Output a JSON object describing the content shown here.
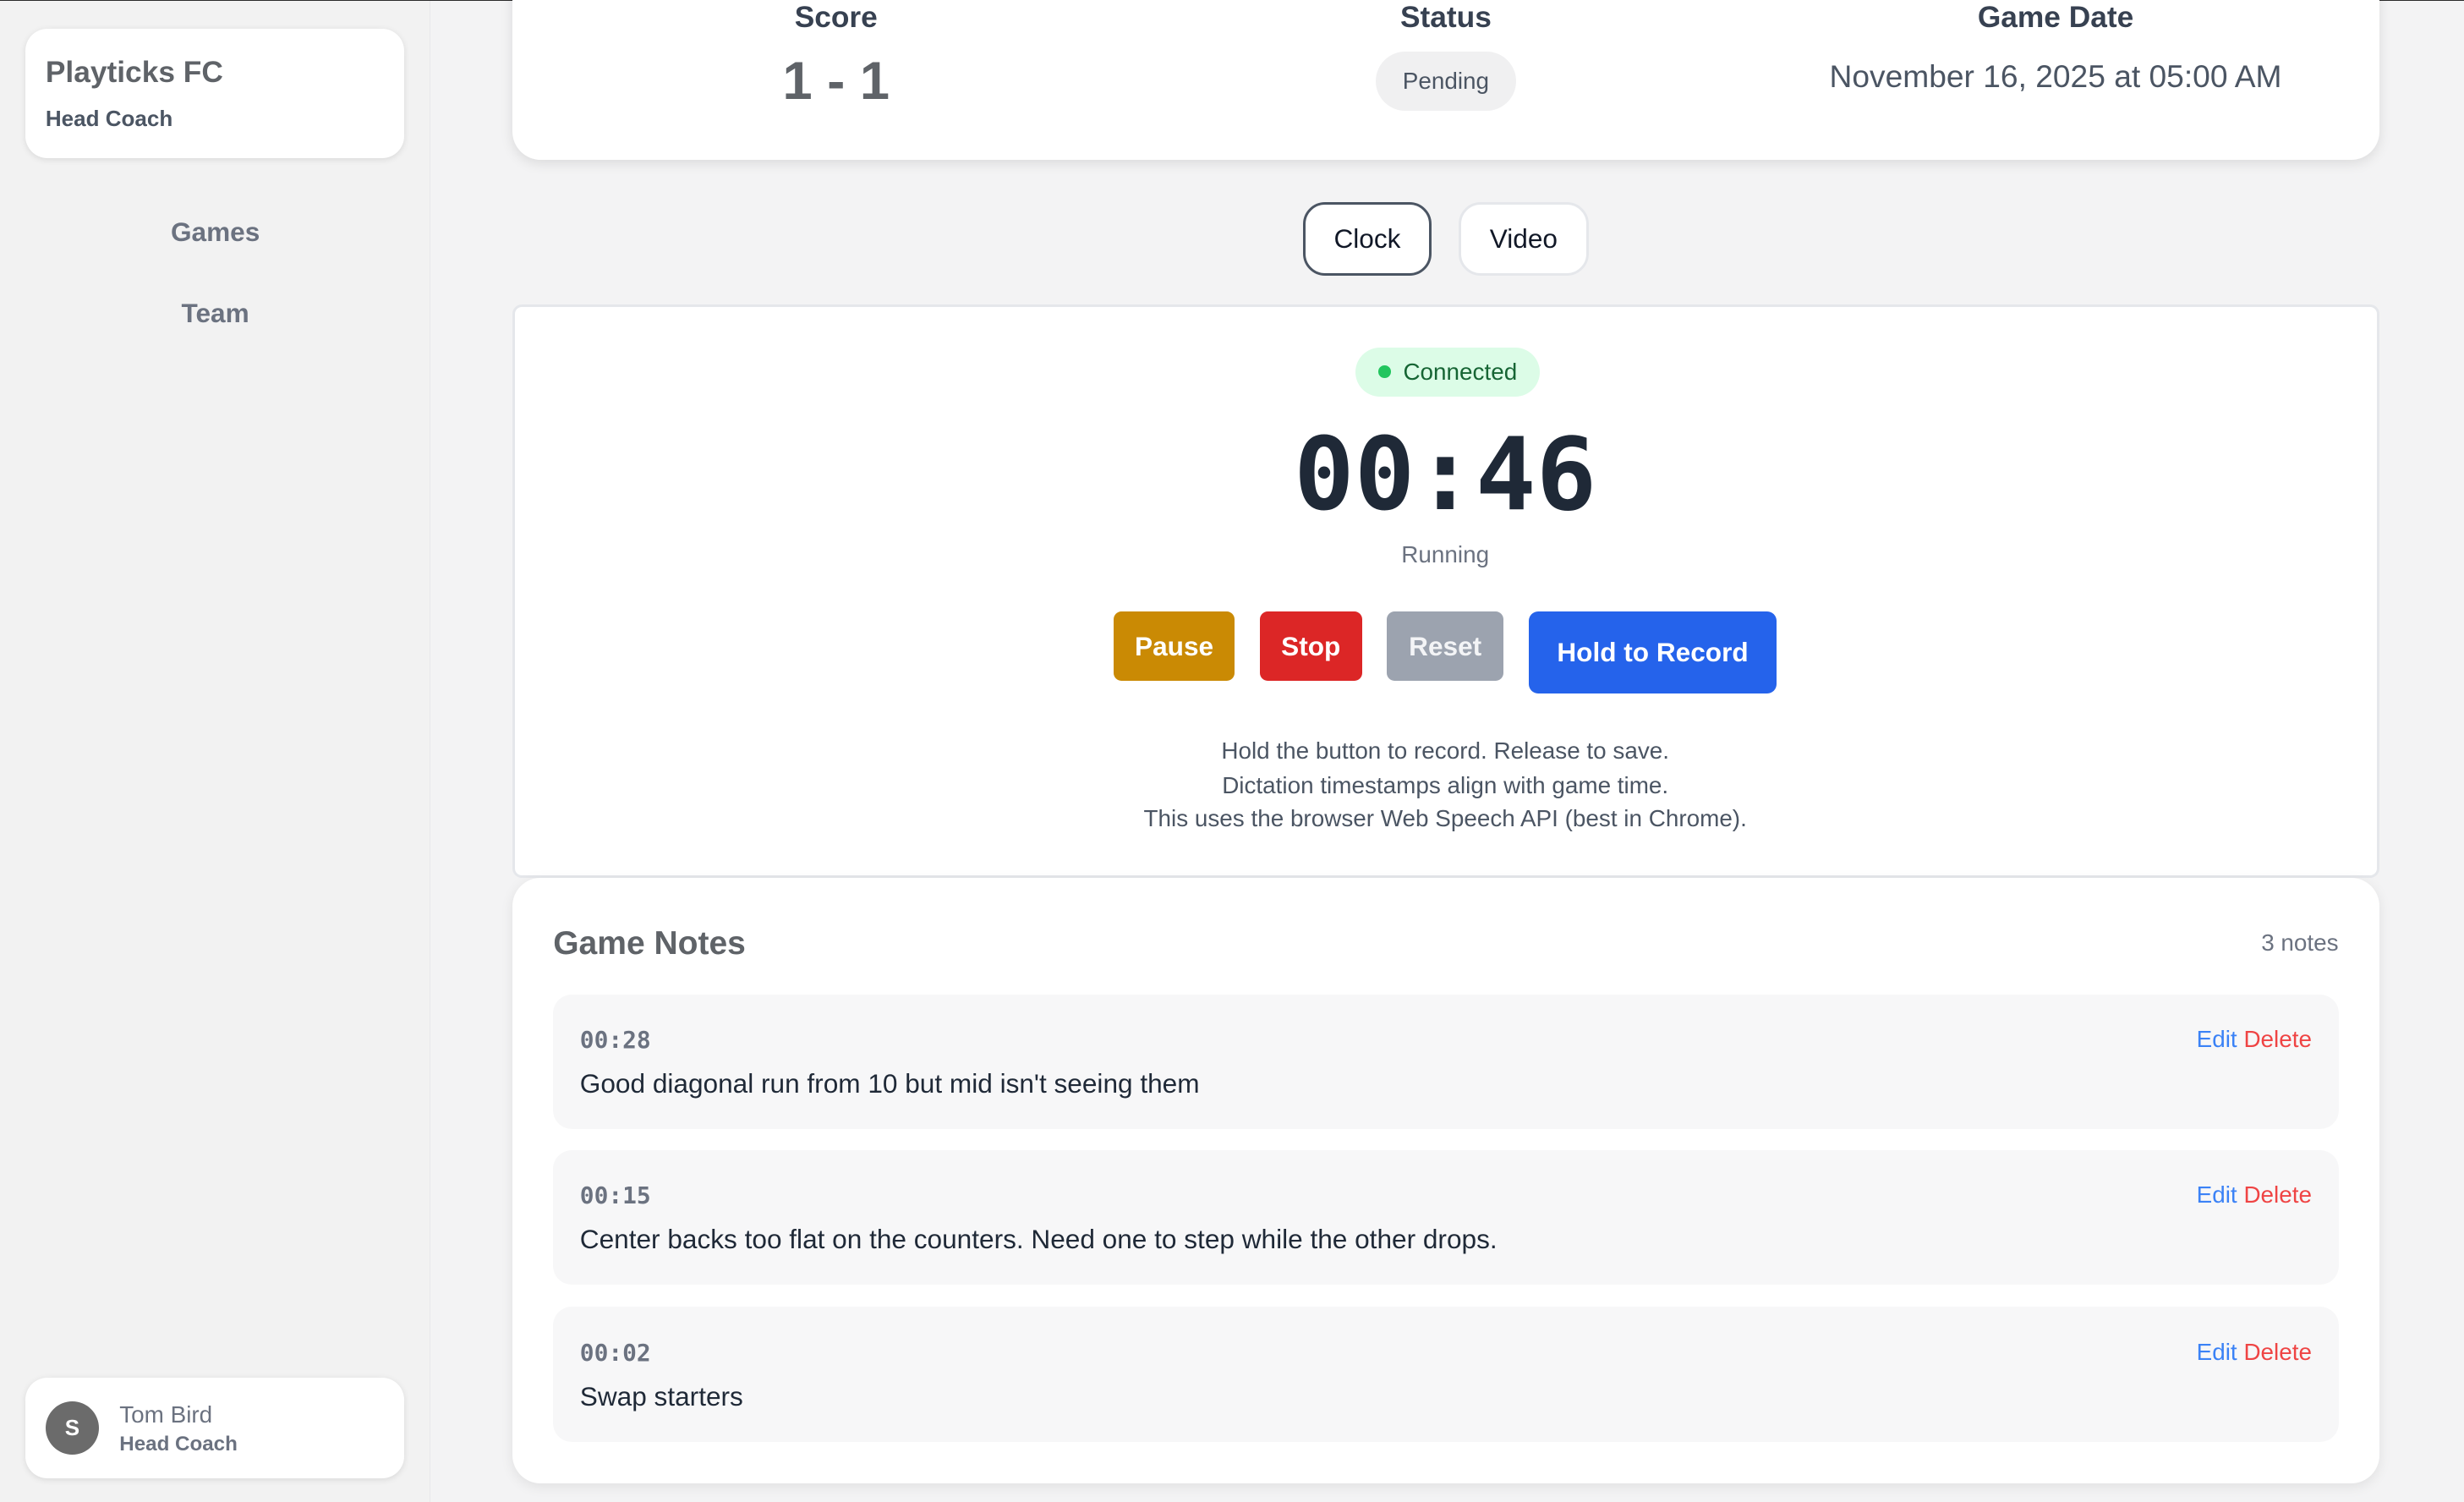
{
  "sidebar": {
    "org_name": "Playticks FC",
    "org_role": "Head Coach",
    "nav": [
      "Games",
      "Team"
    ],
    "user": {
      "initial": "S",
      "name": "Tom Bird",
      "role": "Head Coach"
    }
  },
  "game_info": {
    "score_label": "Score",
    "score": "1 - 1",
    "status_label": "Status",
    "status": "Pending",
    "date_label": "Game Date",
    "date": "November 16, 2025 at 05:00 AM"
  },
  "mode_tabs": {
    "clock": "Clock",
    "video": "Video",
    "active": "Clock"
  },
  "clock": {
    "connection": "Connected",
    "time": "00:46",
    "state": "Running",
    "buttons": {
      "pause": "Pause",
      "stop": "Stop",
      "reset": "Reset",
      "record": "Hold to Record"
    },
    "help": [
      "Hold the button to record. Release to save.",
      "Dictation timestamps align with game time.",
      "This uses the browser Web Speech API (best in Chrome)."
    ]
  },
  "notes": {
    "title": "Game Notes",
    "count": "3 notes",
    "edit_label": "Edit",
    "delete_label": "Delete",
    "items": [
      {
        "time": "00:28",
        "text": "Good diagonal run from 10 but mid isn't seeing them"
      },
      {
        "time": "00:15",
        "text": "Center backs too flat on the counters. Need one to step while the other drops."
      },
      {
        "time": "00:02",
        "text": "Swap starters"
      }
    ]
  },
  "colors": {
    "pause": "#ca8a04",
    "stop": "#dc2626",
    "reset": "#9ca3af",
    "record": "#2563eb",
    "connected_bg": "#dcfce7",
    "connected_dot": "#22c55e",
    "edit": "#3b82f6",
    "delete": "#ef4444"
  }
}
